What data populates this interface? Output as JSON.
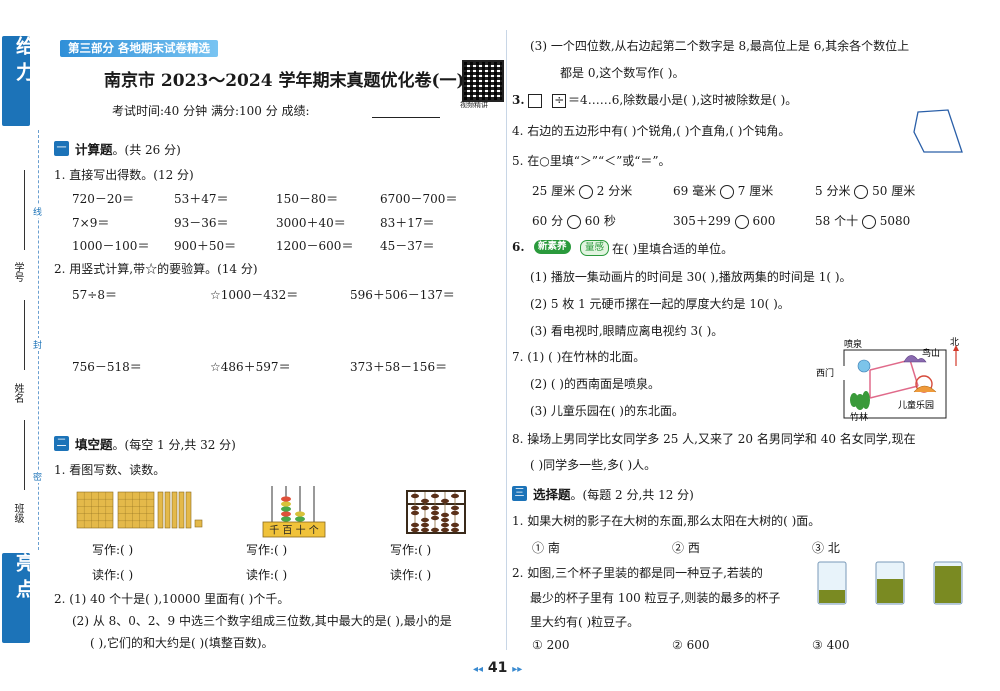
{
  "sidebar": {
    "tab_top": "给 力",
    "tab_bottom": "亮 点",
    "label_xuehao": "学号",
    "label_xingming": "姓名",
    "label_banji": "班级",
    "seal_1": "线",
    "seal_2": "封",
    "seal_3": "密"
  },
  "header": {
    "part_banner": "第三部分  各地期末试卷精选",
    "title": "南京市 2023～2024 学年期末真题优化卷(一)",
    "meta": "考试时间:40 分钟   满分:100 分   成绩:",
    "qr_label": "视频精讲"
  },
  "section1": {
    "num": "一",
    "title": "计算题",
    "note": "。(共 26 分)",
    "q1_title": "1. 直接写出得数。(12 分)",
    "q1_rows": [
      [
        "720－20＝",
        "53＋47＝",
        "150－80＝",
        "6700－700＝"
      ],
      [
        "7×9＝",
        "93－36＝",
        "3000＋40＝",
        "83＋17＝"
      ],
      [
        "1000－100＝",
        "900＋50＝",
        "1200－600＝",
        "45－37＝"
      ]
    ],
    "q2_title": "2. 用竖式计算,带☆的要验算。(14 分)",
    "q2_row1": [
      "57÷8＝",
      "☆1000－432＝",
      "596＋506－137＝"
    ],
    "q2_row2": [
      "756－518＝",
      "☆486＋597＝",
      "373＋58－156＝"
    ]
  },
  "section2": {
    "num": "二",
    "title": "填空题",
    "note": "。(每空 1 分,共 32 分)",
    "q1_title": "1. 看图写数、读数。",
    "abacus_labels": "千 百 十 个",
    "write_label": "写作:(     )",
    "read_label": "读作:(     )",
    "q2_1": "2. (1) 40 个十是(    ),10000 里面有(    )个千。",
    "q2_2a": "(2) 从 8、0、2、9 中选三个数字组成三位数,其中最大的是(    ),最小的是",
    "q2_2b": "(    ),它们的和大约是(    )(填整百数)。"
  },
  "right": {
    "q2_3a": "(3) 一个四位数,从右边起第二个数字是 8,最高位上是 6,其余各个数位上",
    "q2_3b": "都是 0,这个数写作(      )。",
    "q3_num": "3.",
    "q3_text": "÷    ＝4……6,除数最小是(    ),这时被除数是(     )。",
    "q4": "4. 右边的五边形中有(    )个锐角,(    )个直角,(    )个钝角。",
    "q5": "5. 在○里填“＞”“＜”或“＝”。",
    "q5_rows": [
      [
        "25 厘米",
        "2 分米",
        "69 毫米",
        "7 厘米",
        "5 分米",
        "50 厘米"
      ],
      [
        "60 分",
        "60 秒",
        "305＋299",
        "600",
        "58 个十",
        "5080"
      ]
    ],
    "q6_num": "6.",
    "q6_badge": "新素养",
    "q6_badge2": "量感",
    "q6_text": "在(    )里填合适的单位。",
    "q6_1": "(1) 播放一集动画片的时间是 30(    ),播放两集的时间是 1(    )。",
    "q6_2": "(2) 5 枚 1 元硬币摞在一起的厚度大约是 10(    )。",
    "q6_3": "(3) 看电视时,眼睛应离电视约 3(    )。",
    "q7_1": "7. (1) (    )在竹林的北面。",
    "q7_2": "(2) (    )的西南面是喷泉。",
    "q7_3": "(3) 儿童乐园在(     )的东北面。",
    "map": {
      "penquan": "喷泉",
      "niaoshan": "鸟山",
      "ximen": "西门",
      "zhulin": "竹林",
      "letu": "儿童乐园",
      "north": "北"
    },
    "q8a": "8. 操场上男同学比女同学多 25 人,又来了 20 名男同学和 40 名女同学,现在",
    "q8b": "(     )同学多一些,多(    )人。",
    "section3_num": "三",
    "section3_title": "选择题",
    "section3_note": "。(每题 2 分,共 12 分)",
    "s3_q1": "1. 如果大树的影子在大树的东面,那么太阳在大树的(     )面。",
    "s3_q1_opts": [
      "① 南",
      "② 西",
      "③ 北"
    ],
    "s3_q2a": "2. 如图,三个杯子里装的都是同一种豆子,若装的",
    "s3_q2b": "最少的杯子里有 100 粒豆子,则装的最多的杯子",
    "s3_q2c": "里大约有(     )粒豆子。",
    "s3_q2_opts": [
      "① 200",
      "② 600",
      "③ 400"
    ]
  },
  "footer": {
    "page": "41"
  },
  "colors": {
    "accent": "#1c73b8",
    "green": "#2a9a3c"
  }
}
